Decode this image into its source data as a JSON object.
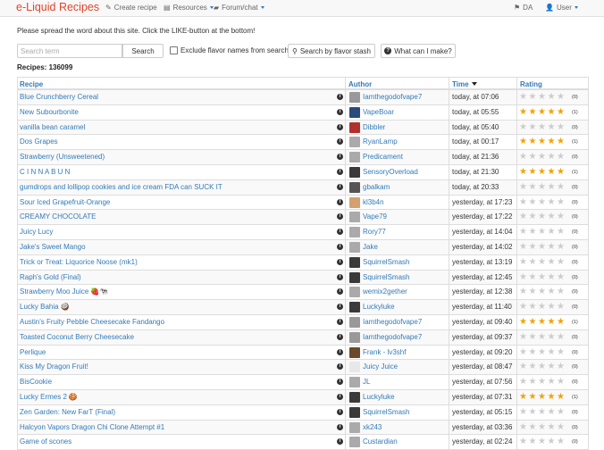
{
  "navbar": {
    "brand": "e-Liquid Recipes",
    "create_label": "Create recipe",
    "resources_label": "Resources",
    "forum_label": "Forum/chat",
    "lang_label": "DA",
    "user_label": "User"
  },
  "notice": "Please spread the word about this site. Click the LIKE-button at the bottom!",
  "search": {
    "placeholder": "Search term",
    "button_label": "Search",
    "exclude_label": "Exclude flavor names from search",
    "stash_label": "Search by flavor stash",
    "what_label": "What can I make?"
  },
  "recipe_count": "Recipes: 136099",
  "columns": [
    "Recipe",
    "Author",
    "Time",
    "Rating"
  ],
  "recipes": [
    {
      "name": "Blue Crunchberry Cereal",
      "author": "Iamthegodofvape7",
      "time": "today, at 07:06",
      "stars": 0,
      "votes": "(0)",
      "avatar": "#999999"
    },
    {
      "name": "New Subourbonite",
      "author": "VapeBoar",
      "time": "today, at 05:55",
      "stars": 5,
      "votes": "(1)",
      "avatar": "#2a4a7a"
    },
    {
      "name": "vanilla bean caramel",
      "author": "Dibbler",
      "time": "today, at 05:40",
      "stars": 0,
      "votes": "(0)",
      "avatar": "#b03030"
    },
    {
      "name": "Dos Grapes",
      "author": "RyanLamp",
      "time": "today, at 00:17",
      "stars": 5,
      "votes": "(1)",
      "avatar": "#aaaaaa"
    },
    {
      "name": "Strawberry (Unsweetened)",
      "author": "Predicament",
      "time": "today, at 21:36",
      "stars": 0,
      "votes": "(0)",
      "avatar": "#aaaaaa"
    },
    {
      "name": "C I N N A B U N",
      "author": "SensoryOverload",
      "time": "today, at 21:30",
      "stars": 5,
      "votes": "(1)",
      "avatar": "#3a3a3a"
    },
    {
      "name": "gumdrops and lollipop cookies and ice cream FDA can SUCK IT",
      "author": "gbalkam",
      "time": "today, at 20:33",
      "stars": 0,
      "votes": "(0)",
      "avatar": "#555555"
    },
    {
      "name": "Sour Iced Grapefruit-Orange",
      "author": "kl3b4n",
      "time": "yesterday, at 17:23",
      "stars": 0,
      "votes": "(0)",
      "avatar": "#d4a070"
    },
    {
      "name": "CREAMY CHOCOLATE",
      "author": "Vape79",
      "time": "yesterday, at 17:22",
      "stars": 0,
      "votes": "(0)",
      "avatar": "#aaaaaa"
    },
    {
      "name": "Juicy Lucy",
      "author": "Rory77",
      "time": "yesterday, at 14:04",
      "stars": 0,
      "votes": "(0)",
      "avatar": "#aaaaaa"
    },
    {
      "name": "Jake's Sweet Mango",
      "author": "Jake",
      "time": "yesterday, at 14:02",
      "stars": 0,
      "votes": "(0)",
      "avatar": "#aaaaaa"
    },
    {
      "name": "Trick or Treat: Liquorice Noose (mk1)",
      "author": "SquirrelSmash",
      "time": "yesterday, at 13:19",
      "stars": 0,
      "votes": "(0)",
      "avatar": "#3a3a3a"
    },
    {
      "name": "Raph's Gold (Final)",
      "author": "SquirrelSmash",
      "time": "yesterday, at 12:45",
      "stars": 0,
      "votes": "(0)",
      "avatar": "#3a3a3a"
    },
    {
      "name": "Strawberry Moo Juice",
      "emoji": "🍓🐄",
      "author": "wemix2gether",
      "time": "yesterday, at 12:38",
      "stars": 0,
      "votes": "(0)",
      "avatar": "#aaaaaa"
    },
    {
      "name": "Lucky Bahia",
      "emoji": "🥥",
      "author": "Luckyluke",
      "time": "yesterday, at 11:40",
      "stars": 0,
      "votes": "(0)",
      "avatar": "#3a3a3a"
    },
    {
      "name": "Austin's Fruity Pebble Cheesecake Fandango",
      "author": "Iamthegodofvape7",
      "time": "yesterday, at 09:40",
      "stars": 5,
      "votes": "(1)",
      "avatar": "#999999"
    },
    {
      "name": "Toasted Coconut Berry Cheesecake",
      "author": "Iamthegodofvape7",
      "time": "yesterday, at 09:37",
      "stars": 0,
      "votes": "(0)",
      "avatar": "#999999"
    },
    {
      "name": "Perlique",
      "author": "Frank - lv3shf",
      "time": "yesterday, at 09:20",
      "stars": 0,
      "votes": "(0)",
      "avatar": "#6a4a2a"
    },
    {
      "name": "Kiss My Dragon Fruit!",
      "author": "Juicy Juice",
      "time": "yesterday, at 08:47",
      "stars": 0,
      "votes": "(0)",
      "avatar": "#e8e8e8"
    },
    {
      "name": "BisCookie",
      "author": "JL",
      "time": "yesterday, at 07:56",
      "stars": 0,
      "votes": "(0)",
      "avatar": "#aaaaaa"
    },
    {
      "name": "Lucky Ermes 2",
      "emoji": "🍪",
      "author": "Luckyluke",
      "time": "yesterday, at 07:31",
      "stars": 5,
      "votes": "(1)",
      "avatar": "#3a3a3a"
    },
    {
      "name": "Zen Garden: New FarT (Final)",
      "author": "SquirrelSmash",
      "time": "yesterday, at 05:15",
      "stars": 0,
      "votes": "(0)",
      "avatar": "#3a3a3a"
    },
    {
      "name": "Halcyon Vapors Dragon Chi Clone Attempt #1",
      "author": "xk243",
      "time": "yesterday, at 03:36",
      "stars": 0,
      "votes": "(0)",
      "avatar": "#aaaaaa"
    },
    {
      "name": "Game of scones",
      "author": "Custardian",
      "time": "yesterday, at 02:24",
      "stars": 0,
      "votes": "(0)",
      "avatar": "#aaaaaa"
    }
  ],
  "colors": {
    "brand": "#e0452b",
    "link": "#337ab7",
    "star_on": "#f0a30a",
    "star_off": "#cccccc",
    "row_stripe": "#f9f9f9"
  },
  "icons": {
    "create": "pencil-icon",
    "resources": "book-icon",
    "forum": "comments-icon",
    "lang": "flag-icon",
    "user": "user-icon",
    "stash": "search-icon",
    "what": "question-icon",
    "info": "info-icon"
  }
}
